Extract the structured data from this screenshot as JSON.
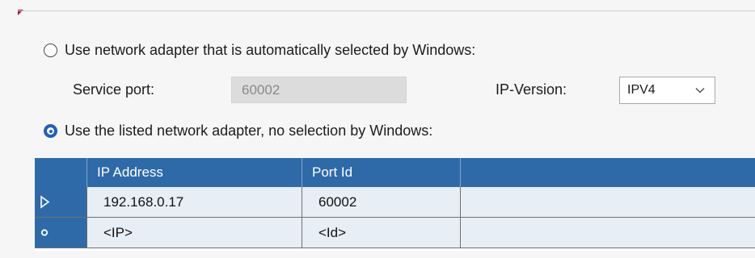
{
  "options": {
    "auto_label": "Use network adapter that is automatically selected by Windows:",
    "listed_label": "Use the listed network adapter, no selection by Windows:",
    "selected": "listed"
  },
  "settings": {
    "service_port_label": "Service port:",
    "service_port_value": "60002",
    "ip_version_label": "IP-Version:",
    "ip_version_value": "IPV4"
  },
  "grid": {
    "columns": [
      "IP Address",
      "Port Id",
      ""
    ],
    "rows": [
      {
        "indicator": "current-row-icon",
        "ip": "192.168.0.17",
        "port": "60002"
      },
      {
        "indicator": "new-row-icon",
        "ip": "<IP>",
        "port": "<Id>"
      }
    ]
  },
  "colors": {
    "grid_header": "#2f6aa8",
    "row_background": "#e8eef6",
    "radio_selected": "#1f5fbf",
    "accent_mark": "#b0103a"
  }
}
